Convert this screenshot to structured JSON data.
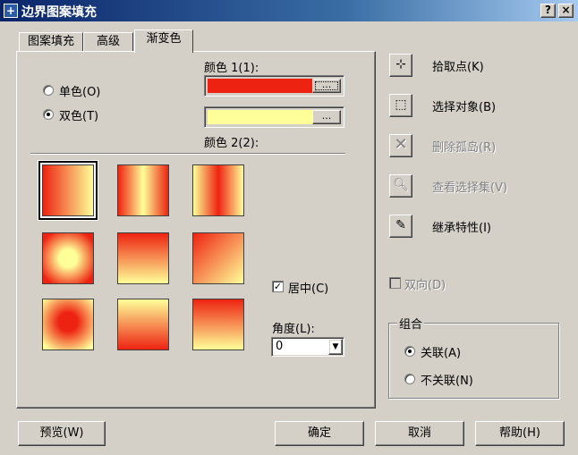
{
  "window": {
    "title": "边界图案填充",
    "help_btn": "?",
    "close_btn": "×"
  },
  "tabs": [
    {
      "label": "图案填充"
    },
    {
      "label": "高级"
    },
    {
      "label": "渐变色"
    }
  ],
  "gradient": {
    "color1_label": "颜色 1(1):",
    "color2_label": "颜色 2(2):",
    "single_label": "单色(O)",
    "two_label": "双色(T)",
    "browse": "...",
    "color1": "#ee2211",
    "color2": "#ffff99",
    "center_label": "居中(C)",
    "center_checked": "✓",
    "angle_label": "角度(L):",
    "angle_value": "0"
  },
  "right": {
    "pick_points": "拾取点(K)",
    "select_objects": "选择对象(B)",
    "remove_islands": "删除孤岛(R)",
    "view_selections": "查看选择集(V)",
    "inherit": "继承特性(I)",
    "double": "双向(D)",
    "group_title": "组合",
    "associative": "关联(A)",
    "nonassociative": "不关联(N)"
  },
  "bottom": {
    "preview": "预览(W)",
    "ok": "确定",
    "cancel": "取消",
    "help": "帮助(H)"
  },
  "icons": {
    "app": "hatch-app-icon",
    "pick": "pick-points-icon",
    "select": "select-objects-icon",
    "remove": "remove-islands-icon",
    "view": "view-selection-icon",
    "inherit": "inherit-properties-icon"
  }
}
